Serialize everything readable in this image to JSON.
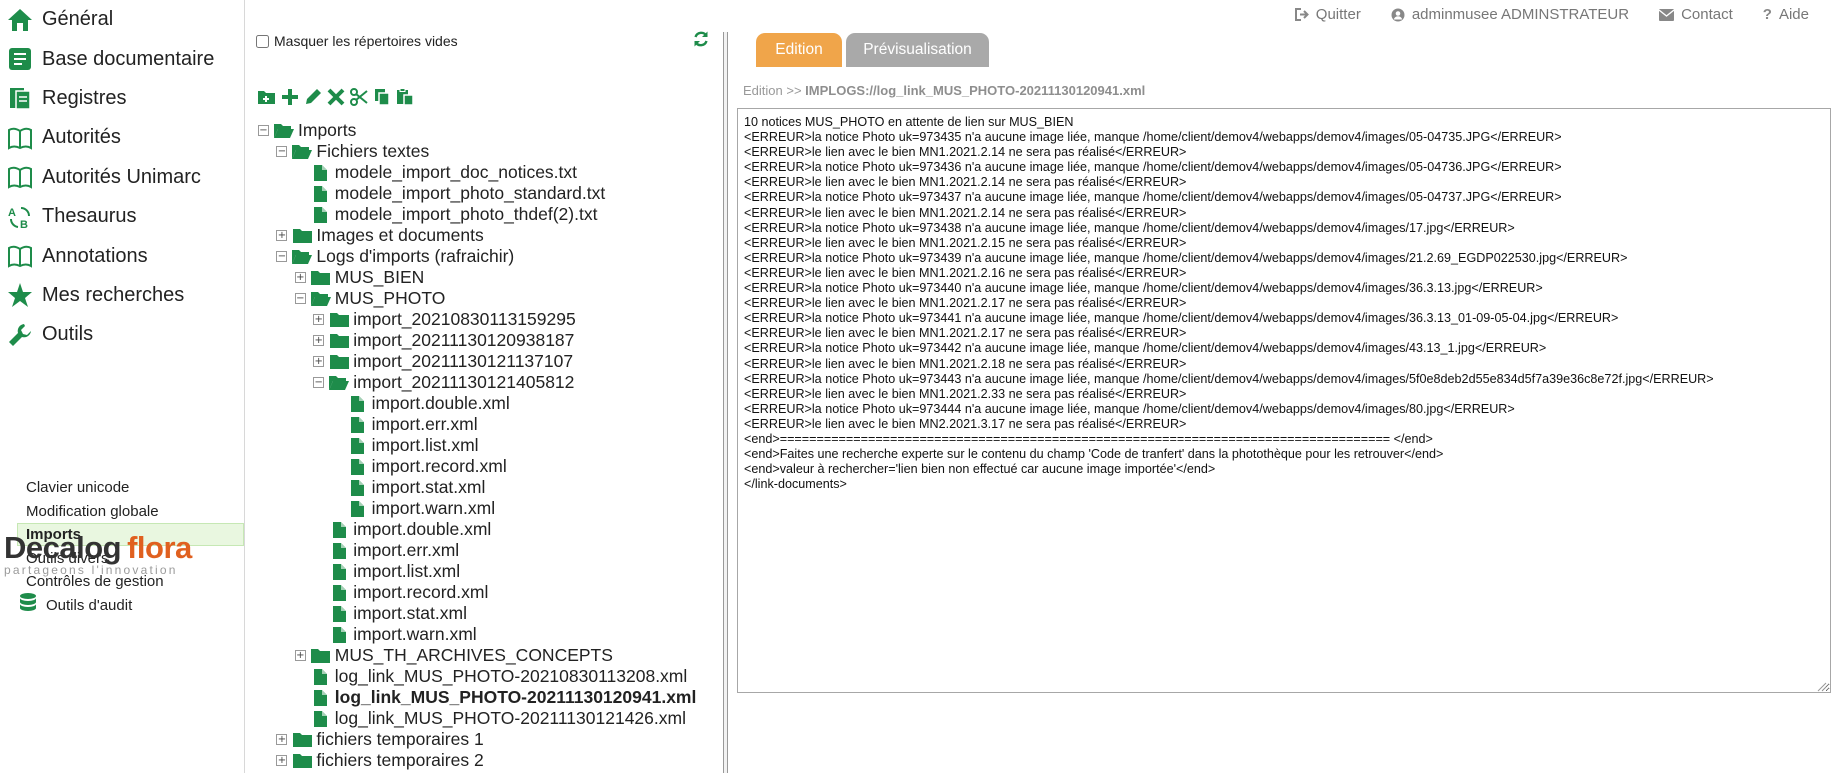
{
  "nav": {
    "main": [
      {
        "label": "Général",
        "icon": "home-icon"
      },
      {
        "label": "Base documentaire",
        "icon": "documents-icon"
      },
      {
        "label": "Registres",
        "icon": "registers-icon"
      },
      {
        "label": "Autorités",
        "icon": "book-icon"
      },
      {
        "label": "Autorités Unimarc",
        "icon": "book-icon"
      },
      {
        "label": "Thesaurus",
        "icon": "thesaurus-icon"
      },
      {
        "label": "Annotations",
        "icon": "book-icon"
      },
      {
        "label": "Mes recherches",
        "icon": "star-icon"
      },
      {
        "label": "Outils",
        "icon": "wrench-icon"
      }
    ],
    "sub": [
      {
        "label": "Clavier unicode"
      },
      {
        "label": "Modification globale"
      },
      {
        "label": "Imports",
        "active": true
      },
      {
        "label": "Outils divers"
      },
      {
        "label": "Contrôles de gestion"
      },
      {
        "label": "Outils d'audit",
        "icon": "database-icon"
      }
    ]
  },
  "logo": {
    "part1": "Decalog",
    "part2": "flora",
    "tagline": "partageons l'innovation"
  },
  "tree_panel": {
    "hide_empty_label": "Masquer les répertoires vides",
    "hide_empty_checked": false,
    "toolbar": [
      "new-folder-icon",
      "add-icon",
      "edit-icon",
      "delete-icon",
      "cut-icon",
      "copy-icon",
      "paste-icon"
    ]
  },
  "tree": [
    {
      "depth": 0,
      "toggle": "−",
      "type": "folder-open",
      "label": "Imports"
    },
    {
      "depth": 1,
      "toggle": "−",
      "type": "folder-open",
      "label": "Fichiers textes"
    },
    {
      "depth": 2,
      "toggle": "",
      "type": "file",
      "label": "modele_import_doc_notices.txt"
    },
    {
      "depth": 2,
      "toggle": "",
      "type": "file",
      "label": "modele_import_photo_standard.txt"
    },
    {
      "depth": 2,
      "toggle": "",
      "type": "file",
      "label": "modele_import_photo_thdef(2).txt"
    },
    {
      "depth": 1,
      "toggle": "+",
      "type": "folder",
      "label": "Images et documents"
    },
    {
      "depth": 1,
      "toggle": "−",
      "type": "folder-open",
      "label": "Logs d'imports (rafraichir)"
    },
    {
      "depth": 2,
      "toggle": "+",
      "type": "folder",
      "label": "MUS_BIEN"
    },
    {
      "depth": 2,
      "toggle": "−",
      "type": "folder-open",
      "label": "MUS_PHOTO"
    },
    {
      "depth": 3,
      "toggle": "+",
      "type": "folder",
      "label": "import_20210830113159295"
    },
    {
      "depth": 3,
      "toggle": "+",
      "type": "folder",
      "label": "import_20211130120938187"
    },
    {
      "depth": 3,
      "toggle": "+",
      "type": "folder",
      "label": "import_20211130121137107"
    },
    {
      "depth": 3,
      "toggle": "−",
      "type": "folder-open",
      "label": "import_20211130121405812"
    },
    {
      "depth": 4,
      "toggle": "",
      "type": "file",
      "label": "import.double.xml"
    },
    {
      "depth": 4,
      "toggle": "",
      "type": "file",
      "label": "import.err.xml"
    },
    {
      "depth": 4,
      "toggle": "",
      "type": "file",
      "label": "import.list.xml"
    },
    {
      "depth": 4,
      "toggle": "",
      "type": "file",
      "label": "import.record.xml"
    },
    {
      "depth": 4,
      "toggle": "",
      "type": "file",
      "label": "import.stat.xml"
    },
    {
      "depth": 4,
      "toggle": "",
      "type": "file",
      "label": "import.warn.xml"
    },
    {
      "depth": 3,
      "toggle": "",
      "type": "file",
      "label": "import.double.xml"
    },
    {
      "depth": 3,
      "toggle": "",
      "type": "file",
      "label": "import.err.xml"
    },
    {
      "depth": 3,
      "toggle": "",
      "type": "file",
      "label": "import.list.xml"
    },
    {
      "depth": 3,
      "toggle": "",
      "type": "file",
      "label": "import.record.xml"
    },
    {
      "depth": 3,
      "toggle": "",
      "type": "file",
      "label": "import.stat.xml"
    },
    {
      "depth": 3,
      "toggle": "",
      "type": "file",
      "label": "import.warn.xml"
    },
    {
      "depth": 2,
      "toggle": "+",
      "type": "folder",
      "label": "MUS_TH_ARCHIVES_CONCEPTS"
    },
    {
      "depth": 2,
      "toggle": "",
      "type": "file",
      "label": "log_link_MUS_PHOTO-20210830113208.xml"
    },
    {
      "depth": 2,
      "toggle": "",
      "type": "file",
      "label": "log_link_MUS_PHOTO-20211130120941.xml",
      "selected": true
    },
    {
      "depth": 2,
      "toggle": "",
      "type": "file",
      "label": "log_link_MUS_PHOTO-20211130121426.xml"
    },
    {
      "depth": 1,
      "toggle": "+",
      "type": "folder",
      "label": "fichiers temporaires 1"
    },
    {
      "depth": 1,
      "toggle": "+",
      "type": "folder",
      "label": "fichiers temporaires 2"
    }
  ],
  "topbar": [
    {
      "label": "Quitter",
      "icon": "logout-icon"
    },
    {
      "label": "adminmusee ADMINSTRATEUR",
      "icon": "user-icon"
    },
    {
      "label": "Contact",
      "icon": "envelope-icon"
    },
    {
      "label": "Aide",
      "icon": "question-icon"
    }
  ],
  "tabs": [
    {
      "label": "Edition",
      "active": true
    },
    {
      "label": "Prévisualisation",
      "active": false
    }
  ],
  "breadcrumb": {
    "prefix": "Edition >> ",
    "path": "IMPLOGS://log_link_MUS_PHOTO-20211130120941.xml"
  },
  "editor_content": "10 notices MUS_PHOTO en attente de lien sur MUS_BIEN\n<ERREUR>la notice Photo uk=973435 n'a aucune image liée, manque /home/client/demov4/webapps/demov4/images/05-04735.JPG</ERREUR>\n<ERREUR>le lien avec le bien MN1.2021.2.14 ne sera pas réalisé</ERREUR>\n<ERREUR>la notice Photo uk=973436 n'a aucune image liée, manque /home/client/demov4/webapps/demov4/images/05-04736.JPG</ERREUR>\n<ERREUR>le lien avec le bien MN1.2021.2.14 ne sera pas réalisé</ERREUR>\n<ERREUR>la notice Photo uk=973437 n'a aucune image liée, manque /home/client/demov4/webapps/demov4/images/05-04737.JPG</ERREUR>\n<ERREUR>le lien avec le bien MN1.2021.2.14 ne sera pas réalisé</ERREUR>\n<ERREUR>la notice Photo uk=973438 n'a aucune image liée, manque /home/client/demov4/webapps/demov4/images/17.jpg</ERREUR>\n<ERREUR>le lien avec le bien MN1.2021.2.15 ne sera pas réalisé</ERREUR>\n<ERREUR>la notice Photo uk=973439 n'a aucune image liée, manque /home/client/demov4/webapps/demov4/images/21.2.69_EGDP022530.jpg</ERREUR>\n<ERREUR>le lien avec le bien MN1.2021.2.16 ne sera pas réalisé</ERREUR>\n<ERREUR>la notice Photo uk=973440 n'a aucune image liée, manque /home/client/demov4/webapps/demov4/images/36.3.13.jpg</ERREUR>\n<ERREUR>le lien avec le bien MN1.2021.2.17 ne sera pas réalisé</ERREUR>\n<ERREUR>la notice Photo uk=973441 n'a aucune image liée, manque /home/client/demov4/webapps/demov4/images/36.3.13_01-09-05-04.jpg</ERREUR>\n<ERREUR>le lien avec le bien MN1.2021.2.17 ne sera pas réalisé</ERREUR>\n<ERREUR>la notice Photo uk=973442 n'a aucune image liée, manque /home/client/demov4/webapps/demov4/images/43.13_1.jpg</ERREUR>\n<ERREUR>le lien avec le bien MN1.2021.2.18 ne sera pas réalisé</ERREUR>\n<ERREUR>la notice Photo uk=973443 n'a aucune image liée, manque /home/client/demov4/webapps/demov4/images/5f0e8deb2d55e834d5f7a39e36c8e72f.jpg</ERREUR>\n<ERREUR>le lien avec le bien MN1.2021.2.33 ne sera pas réalisé</ERREUR>\n<ERREUR>la notice Photo uk=973444 n'a aucune image liée, manque /home/client/demov4/webapps/demov4/images/80.jpg</ERREUR>\n<ERREUR>le lien avec le bien MN2.2021.3.17 ne sera pas réalisé</ERREUR>\n<end>=================================================================================== </end>\n<end>Faites une recherche experte sur le contenu du champ 'Code de tranfert' dans la photothèque pour les retrouver</end>\n<end>valeur à rechercher='lien bien non effectué car aucune image importée'</end>\n</link-documents>",
  "colors": {
    "accent_green": "#1e8c4a",
    "tab_active": "#f0a54a",
    "tab_inactive": "#a9a9a9",
    "logo_orange": "#e0601f"
  }
}
